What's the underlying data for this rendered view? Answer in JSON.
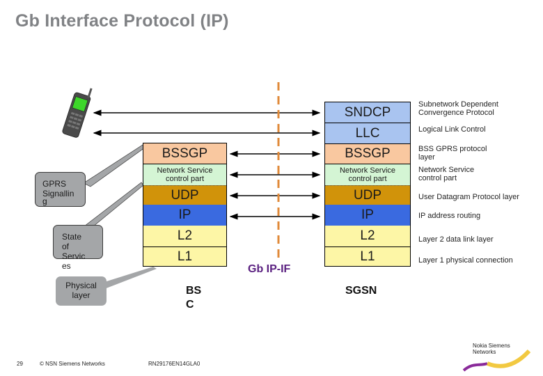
{
  "title": "Gb Interface Protocol (IP)",
  "bsc_stack": {
    "layers": [
      {
        "label": "BSSGP",
        "color": "#f9c8a0"
      },
      {
        "label": "Network Service control part",
        "line1": "Network Service",
        "line2": "control part",
        "color": "#d4f5d4"
      },
      {
        "label": "UDP",
        "color": "#d1930a"
      },
      {
        "label": "IP",
        "color": "#3a6ae0"
      },
      {
        "label": "L2",
        "color": "#fdf6a6"
      },
      {
        "label": "L1",
        "color": "#fdf6a6"
      }
    ]
  },
  "sgsn_stack": {
    "layers": [
      {
        "label": "SNDCP",
        "color": "#a9c4f0"
      },
      {
        "label": "LLC",
        "color": "#a9c4f0"
      },
      {
        "label": "BSSGP",
        "color": "#f9c8a0"
      },
      {
        "label": "Network Service control part",
        "line1": "Network Service",
        "line2": "control part",
        "color": "#d4f5d4"
      },
      {
        "label": "UDP",
        "color": "#d1930a"
      },
      {
        "label": "IP",
        "color": "#3a6ae0"
      },
      {
        "label": "L2",
        "color": "#fdf6a6"
      },
      {
        "label": "L1",
        "color": "#fdf6a6"
      }
    ]
  },
  "descriptions": [
    {
      "line1": "Subnetwork Dependent",
      "line2": "Convergence Protocol"
    },
    {
      "line1": "Logical Link Control",
      "line2": ""
    },
    {
      "line1": "BSS GPRS protocol",
      "line2": "layer"
    },
    {
      "line1": "Network Service",
      "line2": "control part"
    },
    {
      "line1": "User Datagram Protocol layer",
      "line2": ""
    },
    {
      "line1": "IP address routing",
      "line2": ""
    },
    {
      "line1": "Layer 2 data link layer",
      "line2": ""
    },
    {
      "line1": "Layer 1 physical connection",
      "line2": ""
    }
  ],
  "callouts": {
    "gprs_signalling": {
      "line1": "GPRS",
      "line2": "Signallin",
      "line3": "g"
    },
    "state_of_services": {
      "line1": "State",
      "line2": "of",
      "line3": "Servic",
      "line4": "es"
    },
    "physical_layer": {
      "line1": "Physical",
      "line2": "layer"
    }
  },
  "nodes": {
    "bsc_line1": "BS",
    "bsc_line2": "C",
    "sgsn": "SGSN",
    "interface_label": "Gb IP-IF"
  },
  "icons": {
    "mobile_phone": "mobile-phone-icon",
    "logo": "nokia-siemens-networks-logo"
  },
  "colors": {
    "interface_dash": "#e08a3a",
    "title": "#808285",
    "interface_label": "#5a2080"
  },
  "footer": {
    "page_number": "29",
    "copyright": "© NSN Siemens Networks",
    "doc_code": "RN29176EN14GLA0",
    "logo_line1": "Nokia Siemens",
    "logo_line2": "Networks"
  }
}
